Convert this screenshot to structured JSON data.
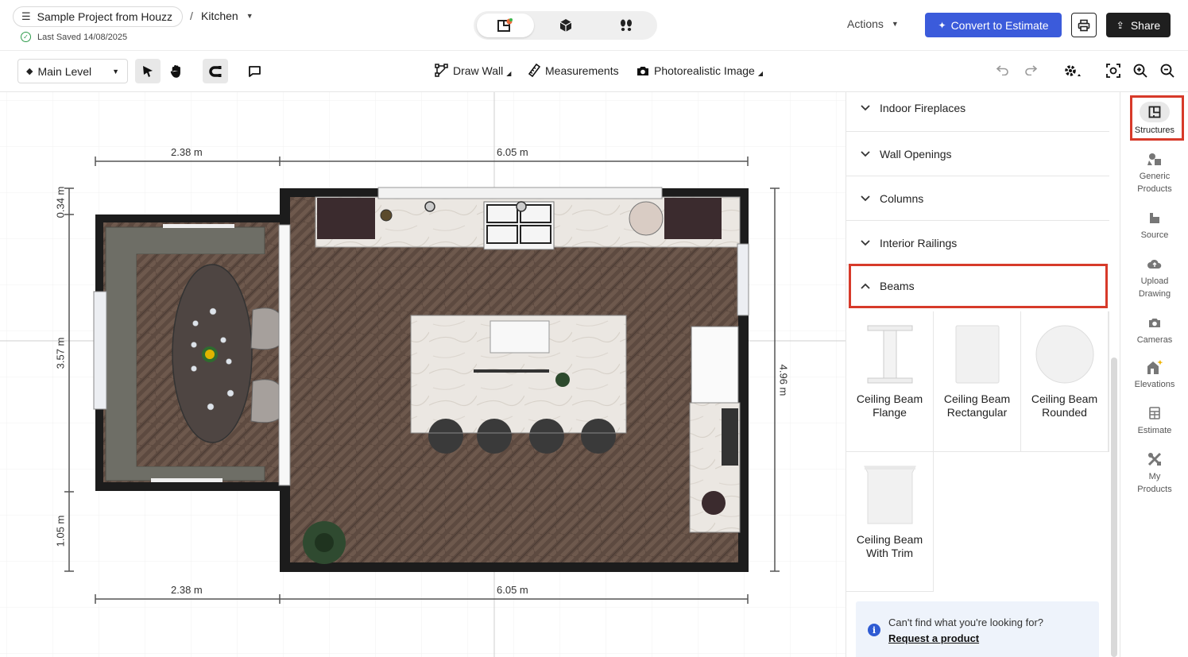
{
  "header": {
    "project_name": "Sample Project from Houzz",
    "separator": "/",
    "room": "Kitchen",
    "last_saved": "Last Saved 14/08/2025",
    "actions_label": "Actions",
    "convert_label": "Convert to Estimate",
    "share_label": "Share"
  },
  "toolbar": {
    "level": "Main Level",
    "draw_wall": "Draw Wall",
    "measurements": "Measurements",
    "photorealistic": "Photorealistic Image"
  },
  "canvas": {
    "dims": {
      "top_left": "2.38 m",
      "top_right": "6.05 m",
      "bottom_left": "2.38 m",
      "bottom_right": "6.05 m",
      "left_top": "0.34 m",
      "left_mid": "3.57 m",
      "left_bottom": "1.05 m",
      "right": "4.96 m"
    },
    "colors": {
      "wall": "#1c1c1c",
      "floor": "#5d4a40",
      "counter": "#e6e2dd",
      "sofa": "#6e6e66"
    }
  },
  "panel": {
    "categories": [
      {
        "label": "Indoor Fireplaces",
        "expanded": false
      },
      {
        "label": "Wall Openings",
        "expanded": false
      },
      {
        "label": "Columns",
        "expanded": false
      },
      {
        "label": "Interior Railings",
        "expanded": false
      },
      {
        "label": "Beams",
        "expanded": true
      }
    ],
    "products": [
      {
        "name": "Ceiling Beam Flange",
        "icon": "beam-flange-thumb"
      },
      {
        "name": "Ceiling Beam Rectangular",
        "icon": "beam-rect-thumb"
      },
      {
        "name": "Ceiling Beam Rounded",
        "icon": "beam-round-thumb"
      },
      {
        "name": "Ceiling Beam With Trim",
        "icon": "beam-trim-thumb"
      }
    ],
    "help_question": "Can't find what you're looking for?",
    "help_link": "Request a product"
  },
  "rail": {
    "items": [
      {
        "label": "Structures",
        "icon": "structures-icon",
        "active": true
      },
      {
        "label": "Generic Products",
        "icon": "generic-products-icon"
      },
      {
        "label": "Source",
        "icon": "source-icon"
      },
      {
        "label": "Upload Drawing",
        "icon": "upload-icon"
      },
      {
        "label": "Cameras",
        "icon": "camera-icon"
      },
      {
        "label": "Elevations",
        "icon": "elevations-icon"
      },
      {
        "label": "Estimate",
        "icon": "estimate-icon"
      },
      {
        "label": "My Products",
        "icon": "my-products-icon"
      }
    ]
  },
  "colors": {
    "accent": "#3b5bdb",
    "highlight": "#d73a2a",
    "dark": "#1f1f1f"
  }
}
